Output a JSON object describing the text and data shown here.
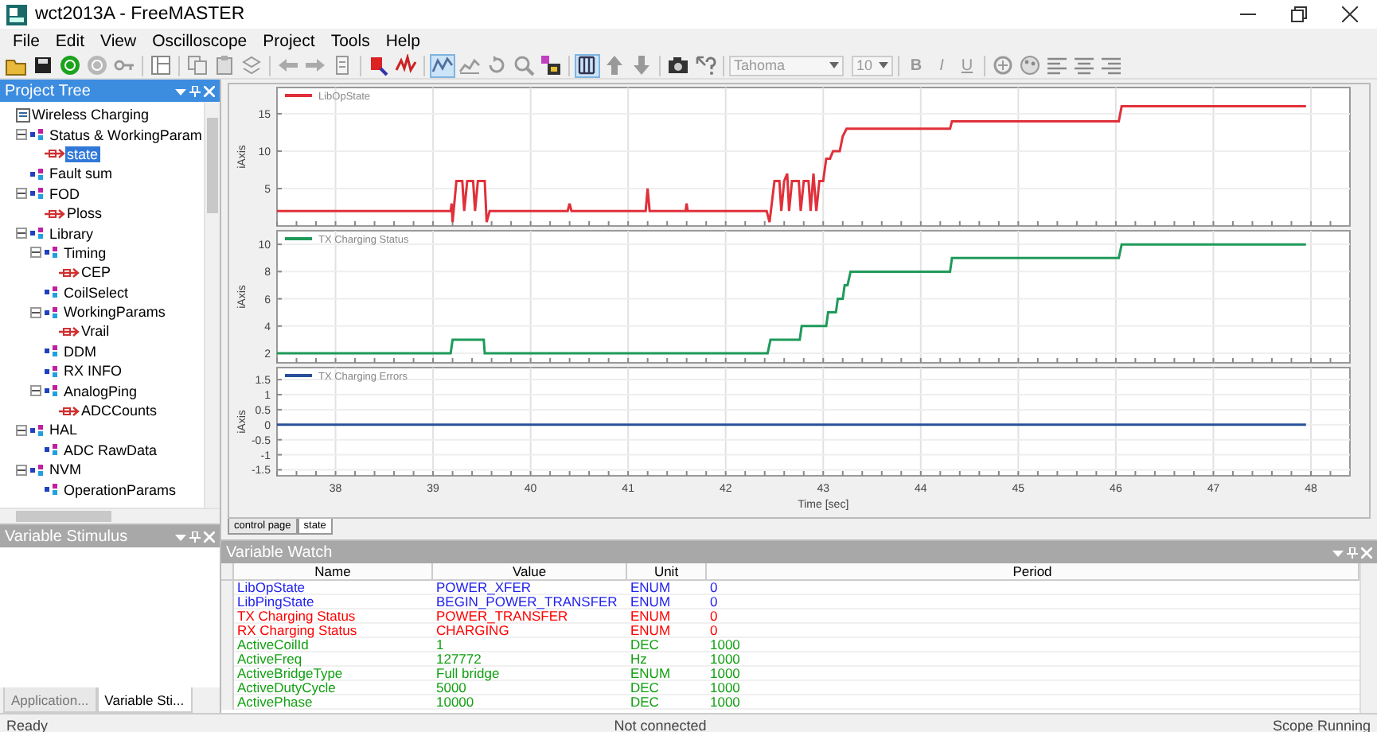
{
  "window": {
    "title": "wct2013A - FreeMASTER"
  },
  "menu": [
    "File",
    "Edit",
    "View",
    "Oscilloscope",
    "Project",
    "Tools",
    "Help"
  ],
  "toolbar": [
    {
      "kind": "open",
      "pressed": false
    },
    {
      "kind": "save",
      "pressed": false
    },
    {
      "kind": "connect",
      "pressed": false
    },
    {
      "kind": "disconnect",
      "pressed": false
    },
    {
      "kind": "key",
      "pressed": false
    },
    {
      "kind": "separator"
    },
    {
      "kind": "layout",
      "pressed": false
    },
    {
      "kind": "separator"
    },
    {
      "kind": "copy",
      "pressed": false
    },
    {
      "kind": "paste",
      "pressed": false
    },
    {
      "kind": "stack",
      "pressed": false
    },
    {
      "kind": "separator"
    },
    {
      "kind": "back",
      "pressed": false
    },
    {
      "kind": "forward",
      "pressed": false
    },
    {
      "kind": "page",
      "pressed": false
    },
    {
      "kind": "separator"
    },
    {
      "kind": "chip",
      "pressed": false
    },
    {
      "kind": "jpy",
      "pressed": false
    },
    {
      "kind": "separator"
    },
    {
      "kind": "scope",
      "pressed": true
    },
    {
      "kind": "recorder",
      "pressed": false
    },
    {
      "kind": "rotate",
      "pressed": false
    },
    {
      "kind": "zoom",
      "pressed": false
    },
    {
      "kind": "watch",
      "pressed": false
    },
    {
      "kind": "separator"
    },
    {
      "kind": "grid",
      "pressed": true
    },
    {
      "kind": "up",
      "pressed": false
    },
    {
      "kind": "down",
      "pressed": false
    },
    {
      "kind": "separator"
    },
    {
      "kind": "camera",
      "pressed": false
    },
    {
      "kind": "help",
      "pressed": false
    }
  ],
  "font_box": {
    "value": "Tahoma"
  },
  "size_box": {
    "value": "10"
  },
  "format_buttons": [
    {
      "kind": "bold",
      "label": "B"
    },
    {
      "kind": "italic",
      "label": "I"
    },
    {
      "kind": "underline",
      "label": "U"
    }
  ],
  "toolbar_end": [
    {
      "kind": "shapes"
    },
    {
      "kind": "palette"
    },
    {
      "kind": "align-left"
    },
    {
      "kind": "align-center"
    },
    {
      "kind": "align-right"
    }
  ],
  "project_tree": {
    "title": "Project Tree",
    "items": [
      {
        "label": "Wireless Charging",
        "kind": "project",
        "selected": false,
        "children": [
          {
            "label": "Status & WorkingParam",
            "kind": "folder",
            "selected": false,
            "expanded": true,
            "children": [
              {
                "label": "state",
                "kind": "variable",
                "selected": true
              }
            ]
          },
          {
            "label": "Fault sum",
            "kind": "folder",
            "selected": false
          },
          {
            "label": "FOD",
            "kind": "folder",
            "selected": false,
            "expanded": true,
            "children": [
              {
                "label": "Ploss",
                "kind": "variable",
                "selected": false
              }
            ]
          },
          {
            "label": "Library",
            "kind": "folder",
            "selected": false,
            "expanded": true,
            "children": [
              {
                "label": "Timing",
                "kind": "folder",
                "selected": false,
                "expanded": true,
                "children": [
                  {
                    "label": "CEP",
                    "kind": "variable",
                    "selected": false
                  }
                ]
              },
              {
                "label": "CoilSelect",
                "kind": "folder",
                "selected": false
              },
              {
                "label": "WorkingParams",
                "kind": "folder",
                "selected": false,
                "expanded": true,
                "children": [
                  {
                    "label": "Vrail",
                    "kind": "variable",
                    "selected": false
                  }
                ]
              },
              {
                "label": "DDM",
                "kind": "folder",
                "selected": false
              },
              {
                "label": "RX INFO",
                "kind": "folder",
                "selected": false
              },
              {
                "label": "AnalogPing",
                "kind": "folder",
                "selected": false,
                "expanded": true,
                "children": [
                  {
                    "label": "ADCCounts",
                    "kind": "variable",
                    "selected": false
                  }
                ]
              }
            ]
          },
          {
            "label": "HAL",
            "kind": "folder",
            "selected": false,
            "expanded": true,
            "children": [
              {
                "label": "ADC RawData",
                "kind": "folder",
                "selected": false
              }
            ]
          },
          {
            "label": "NVM",
            "kind": "folder",
            "selected": false,
            "expanded": true,
            "children": [
              {
                "label": "OperationParams",
                "kind": "folder",
                "selected": false
              }
            ]
          }
        ]
      }
    ]
  },
  "stimulus_pane": {
    "title": "Variable Stimulus",
    "tabs": [
      {
        "label": "Application...",
        "selected": false
      },
      {
        "label": "Variable Sti...",
        "selected": true
      }
    ]
  },
  "plots": [
    {
      "chart_data": {
        "type": "line",
        "grid": true,
        "ylabel": "iAxis",
        "xlim": [
          37.4,
          48.4
        ],
        "ylim": [
          0,
          18.5
        ],
        "yticks": [
          5,
          10,
          15
        ],
        "x": [
          37.4,
          39.18,
          39.19,
          39.2,
          39.24,
          39.3,
          39.32,
          39.35,
          39.41,
          39.43,
          39.46,
          39.53,
          39.55,
          39.58,
          40.38,
          40.4,
          40.42,
          41.18,
          41.2,
          41.22,
          41.59,
          41.6,
          41.61,
          42.42,
          42.45,
          42.5,
          42.55,
          42.57,
          42.6,
          42.63,
          42.65,
          42.68,
          42.75,
          42.77,
          42.8,
          42.85,
          42.87,
          42.9,
          42.93,
          42.96,
          43.0,
          43.03,
          43.07,
          43.1,
          43.17,
          43.2,
          43.24,
          44.3,
          44.32,
          46.03,
          46.06,
          47.95
        ],
        "series": [
          {
            "name": "LibOpState",
            "color": "#e0303a",
            "values": [
              2,
              2,
              3,
              0.5,
              6,
              6,
              2,
              6,
              6,
              2,
              6,
              6,
              0.5,
              2,
              2,
              3,
              2,
              2,
              5,
              2,
              2,
              3,
              2,
              2,
              0.5,
              6,
              6,
              2,
              6,
              7,
              2,
              6,
              6,
              2,
              6,
              6,
              2,
              7,
              2,
              6,
              6,
              9,
              9,
              10,
              10,
              12,
              13,
              13,
              14,
              14,
              16,
              16
            ]
          }
        ]
      }
    },
    {
      "chart_data": {
        "type": "line",
        "grid": true,
        "ylabel": "iAxis",
        "xlim": [
          37.4,
          48.4
        ],
        "ylim": [
          1.3,
          11
        ],
        "yticks": [
          2,
          4,
          6,
          8,
          10
        ],
        "x": [
          37.4,
          39.18,
          39.2,
          39.52,
          39.53,
          42.43,
          42.46,
          42.76,
          42.78,
          43.03,
          43.05,
          43.13,
          43.15,
          43.2,
          43.22,
          43.25,
          43.28,
          44.3,
          44.32,
          46.03,
          46.06,
          47.95
        ],
        "series": [
          {
            "name": "TX Charging Status",
            "color": "#1e9a5a",
            "values": [
              2,
              2,
              3,
              3,
              2,
              2,
              3,
              3,
              4,
              4,
              5,
              5,
              6,
              6,
              7,
              7,
              8,
              8,
              9,
              9,
              10,
              10
            ]
          }
        ]
      }
    },
    {
      "chart_data": {
        "type": "line",
        "grid": true,
        "ylabel": "iAxis",
        "xlabel": "Time [sec]",
        "xlim": [
          37.4,
          48.4
        ],
        "ylim": [
          -1.7,
          1.9
        ],
        "yticks": [
          -1.5,
          -1,
          -0.5,
          0,
          0.5,
          1,
          1.5
        ],
        "xticks": [
          38,
          39,
          40,
          41,
          42,
          43,
          44,
          45,
          46,
          47,
          48
        ],
        "x": [
          37.4,
          47.95
        ],
        "series": [
          {
            "name": "TX Charging Errors",
            "color": "#2a4f9a",
            "values": [
              0,
              0
            ]
          }
        ]
      }
    }
  ],
  "doc_tabs": [
    {
      "label": "control page",
      "selected": false
    },
    {
      "label": "state",
      "selected": true
    }
  ],
  "watch": {
    "title": "Variable Watch",
    "columns": [
      "Name",
      "Value",
      "Unit",
      "Period"
    ],
    "rows": [
      {
        "name": "LibOpState",
        "value": "POWER_XFER",
        "unit": "ENUM",
        "period": "0",
        "color": "#2222ee"
      },
      {
        "name": "LibPingState",
        "value": "BEGIN_POWER_TRANSFER",
        "unit": "ENUM",
        "period": "0",
        "color": "#2222ee"
      },
      {
        "name": "TX Charging Status",
        "value": "POWER_TRANSFER",
        "unit": "ENUM",
        "period": "0",
        "color": "#ff0000"
      },
      {
        "name": "RX Charging Status",
        "value": "CHARGING",
        "unit": "ENUM",
        "period": "0",
        "color": "#ff0000"
      },
      {
        "name": "ActiveCoilId",
        "value": "1",
        "unit": "DEC",
        "period": "1000",
        "color": "#12a012"
      },
      {
        "name": "ActiveFreq",
        "value": "127772",
        "unit": "Hz",
        "period": "1000",
        "color": "#12a012"
      },
      {
        "name": "ActiveBridgeType",
        "value": "Full bridge",
        "unit": "ENUM",
        "period": "1000",
        "color": "#12a012"
      },
      {
        "name": "ActiveDutyCycle",
        "value": "5000",
        "unit": "DEC",
        "period": "1000",
        "color": "#12a012"
      },
      {
        "name": "ActivePhase",
        "value": "10000",
        "unit": "DEC",
        "period": "1000",
        "color": "#12a012"
      }
    ]
  },
  "status_bar": {
    "ready": "Ready",
    "connection": "Not connected",
    "scope": "Scope Running"
  }
}
